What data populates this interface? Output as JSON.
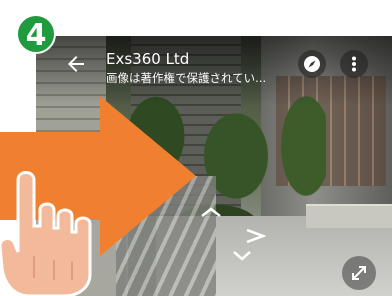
{
  "step": {
    "number": "4",
    "color": "#1f9a3e"
  },
  "header": {
    "title": "Exs360 Ltd",
    "subtitle": "画像は著作権で保護されてい..."
  },
  "icons": {
    "back": "arrow-left-icon",
    "compass": "compass-icon",
    "more": "more-vert-icon",
    "expand": "expand-icon",
    "navigate": "chevron-icon"
  },
  "colors": {
    "arrow": "#f08030",
    "hand": "#f2b99a"
  }
}
